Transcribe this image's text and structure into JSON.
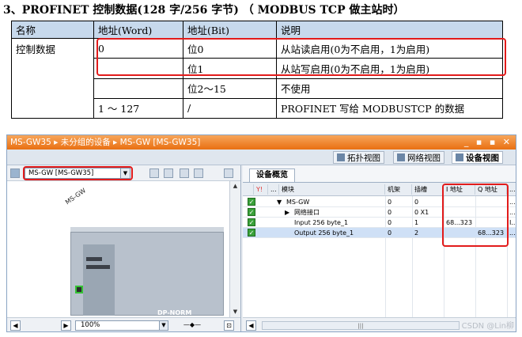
{
  "doc": {
    "title": "3、PROFINET 控制数据(128 字/256 字节) （ MODBUS TCP 做主站时）",
    "table": {
      "headers": [
        "名称",
        "地址(Word)",
        "地址(Bit)",
        "说明"
      ],
      "rows": [
        [
          "控制数据",
          "0",
          "位0",
          "从站读启用(0为不启用，1为启用)"
        ],
        [
          "",
          "",
          "位1",
          "从站写启用(0为不启用，1为启用)"
        ],
        [
          "",
          "",
          "位2～15",
          "不使用"
        ],
        [
          "",
          "1 ～ 127",
          "/",
          "PROFINET 写给 MODBUSTCP 的数据"
        ]
      ]
    }
  },
  "window": {
    "title": "MS-GW35 ▸ 未分组的设备 ▸ MS-GW [MS-GW35]",
    "controls": "_ ▪ ▪ ✕",
    "view_tabs": [
      {
        "label": "拓扑视图",
        "active": false
      },
      {
        "label": "网络视图",
        "active": false
      },
      {
        "label": "设备视图",
        "active": true
      }
    ],
    "left": {
      "device_selector": "MS-GW [MS-GW35]",
      "device_label": "MS-GW",
      "module_label": "DP-NORM",
      "zoom": "100%"
    },
    "right": {
      "tab": "设备概览",
      "columns": [
        "",
        "...",
        "模块",
        "机架",
        "插槽",
        "I 地址",
        "Q 地址",
        "..."
      ],
      "rows": [
        {
          "expand": "▼",
          "module": "MS-GW",
          "rack": "0",
          "slot": "0",
          "i_addr": "",
          "q_addr": "",
          "more": "...",
          "selected": false,
          "indent": 0
        },
        {
          "expand": "▶",
          "module": "网络接口",
          "rack": "0",
          "slot": "0 X1",
          "i_addr": "",
          "q_addr": "",
          "more": "...",
          "selected": false,
          "indent": 1
        },
        {
          "expand": "",
          "module": "Input 256 byte_1",
          "rack": "0",
          "slot": "1",
          "i_addr": "68...323",
          "q_addr": "",
          "more": "I...",
          "selected": false,
          "indent": 1
        },
        {
          "expand": "",
          "module": "Output 256 byte_1",
          "rack": "0",
          "slot": "2",
          "i_addr": "",
          "q_addr": "68...323",
          "more": "...",
          "selected": true,
          "indent": 1
        }
      ],
      "scroll_mark": "|||",
      "watermark": "CSDN @Lin柳"
    }
  },
  "colors": {
    "title_bar": "#e96f12",
    "highlight": "#e21b1b",
    "table_header": "#c7d9ec",
    "selected_row": "#cfe0f6"
  }
}
